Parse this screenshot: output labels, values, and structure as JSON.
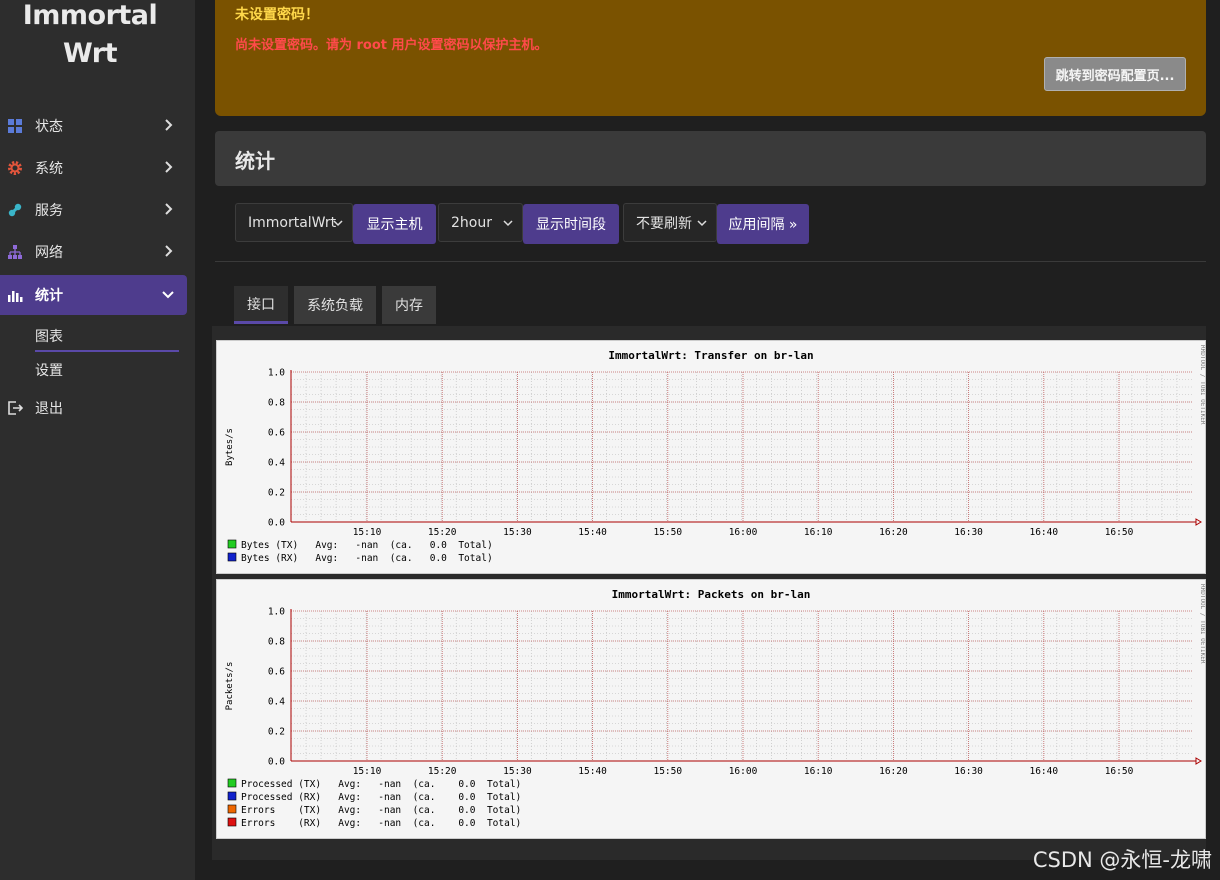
{
  "sidebar": {
    "logo_line1": "Immortal",
    "logo_line2": "Wrt",
    "items": [
      {
        "label": "状态",
        "icon": "dashboard-icon"
      },
      {
        "label": "系统",
        "icon": "gear-icon"
      },
      {
        "label": "服务",
        "icon": "services-icon"
      },
      {
        "label": "网络",
        "icon": "network-icon"
      },
      {
        "label": "统计",
        "icon": "bar-chart-icon"
      }
    ],
    "sub_items": [
      {
        "label": "图表"
      },
      {
        "label": "设置"
      }
    ],
    "logout": {
      "label": "退出",
      "icon": "logout-icon"
    }
  },
  "alert": {
    "title": "未设置密码！",
    "message": "尚未设置密码。请为 root 用户设置密码以保护主机。",
    "button": "跳转到密码配置页..."
  },
  "section": {
    "title": "统计"
  },
  "controls": {
    "host_select": "ImmortalWrt",
    "host_button": "显示主机",
    "timespan_select": "2hour",
    "timespan_button": "显示时间段",
    "refresh_select": "不要刷新",
    "refresh_button": "应用间隔 »"
  },
  "tabs": [
    {
      "label": "接口",
      "active": true
    },
    {
      "label": "系统负载",
      "active": false
    },
    {
      "label": "内存",
      "active": false
    }
  ],
  "colors": {
    "accent": "#4e3c8d",
    "alert_bg": "#7a5200",
    "alert_title": "#ffd84a",
    "alert_msg": "#ff4a4a"
  },
  "chart_data": [
    {
      "type": "line",
      "title": "ImmortalWrt: Transfer on br-lan",
      "ylabel": "Bytes/s",
      "side_label": "RRDTOOL / TOBI OETIKER",
      "ylim": [
        0.0,
        1.0
      ],
      "yticks": [
        "0.0",
        "0.2",
        "0.4",
        "0.6",
        "0.8",
        "1.0"
      ],
      "xticks": [
        "15:10",
        "15:20",
        "15:30",
        "15:40",
        "15:50",
        "16:00",
        "16:10",
        "16:20",
        "16:30",
        "16:40",
        "16:50"
      ],
      "grid": true,
      "legend": [
        {
          "color": "#22cc22",
          "text": "Bytes (TX)   Avg:   -nan  (ca.   0.0  Total)"
        },
        {
          "color": "#1122cc",
          "text": "Bytes (RX)   Avg:   -nan  (ca.   0.0  Total)"
        }
      ]
    },
    {
      "type": "line",
      "title": "ImmortalWrt: Packets on br-lan",
      "ylabel": "Packets/s",
      "side_label": "RRDTOOL / TOBI OETIKER",
      "ylim": [
        0.0,
        1.0
      ],
      "yticks": [
        "0.0",
        "0.2",
        "0.4",
        "0.6",
        "0.8",
        "1.0"
      ],
      "xticks": [
        "15:10",
        "15:20",
        "15:30",
        "15:40",
        "15:50",
        "16:00",
        "16:10",
        "16:20",
        "16:30",
        "16:40",
        "16:50"
      ],
      "grid": true,
      "legend": [
        {
          "color": "#22cc22",
          "text": "Processed (TX)   Avg:   -nan  (ca.    0.0  Total)"
        },
        {
          "color": "#1122cc",
          "text": "Processed (RX)   Avg:   -nan  (ca.    0.0  Total)"
        },
        {
          "color": "#ee6600",
          "text": "Errors    (TX)   Avg:   -nan  (ca.    0.0  Total)"
        },
        {
          "color": "#dd1111",
          "text": "Errors    (RX)   Avg:   -nan  (ca.    0.0  Total)"
        }
      ]
    }
  ],
  "watermark": "CSDN @永恒-龙啸"
}
